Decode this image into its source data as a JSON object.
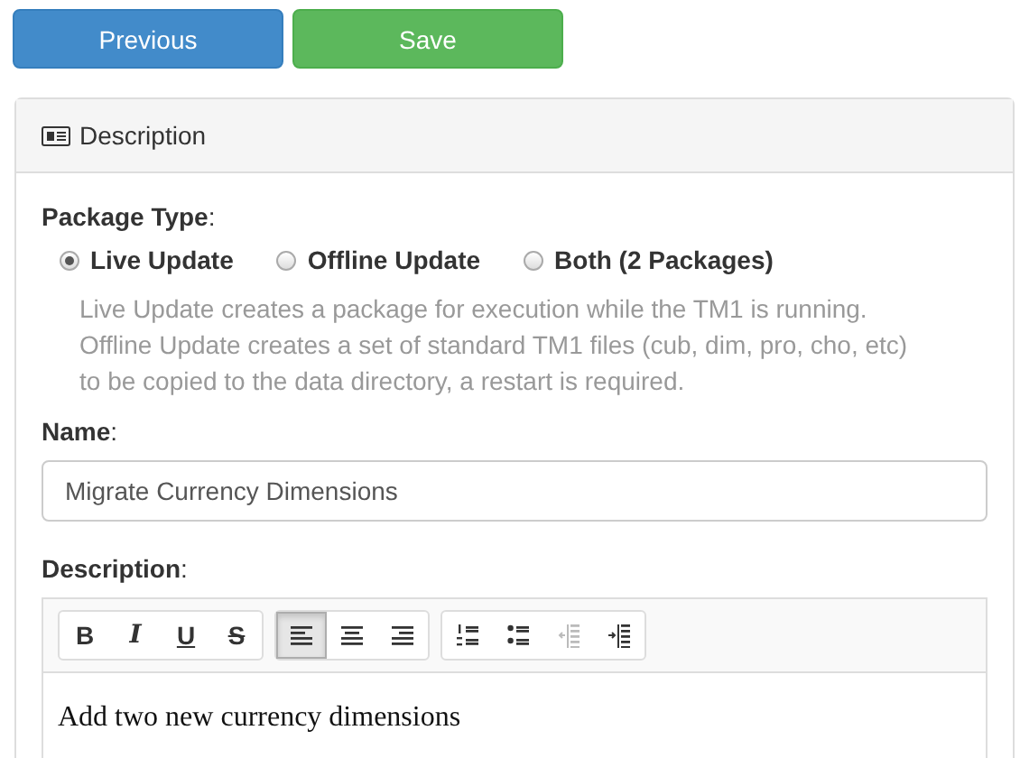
{
  "buttons": [
    {
      "label": "Previous",
      "kind": "primary"
    },
    {
      "label": "Save",
      "kind": "success"
    }
  ],
  "panel": {
    "title": "Description",
    "package_type": {
      "label": "Package Type",
      "suffix": ":",
      "options": [
        {
          "label": "Live Update",
          "selected": true
        },
        {
          "label": "Offline Update",
          "selected": false
        },
        {
          "label": "Both (2 Packages)",
          "selected": false
        }
      ],
      "help": [
        "Live Update creates a package for execution while the TM1 is running.",
        "Offline Update creates a set of standard TM1 files (cub, dim, pro, cho, etc)",
        "to be copied to the data directory, a restart is required."
      ]
    },
    "name": {
      "label": "Name",
      "suffix": ":",
      "value": "Migrate Currency Dimensions"
    },
    "description": {
      "label": "Description",
      "suffix": ":",
      "toolbar": [
        [
          {
            "kind": "bold",
            "label": "B",
            "selected": false,
            "disabled": false
          },
          {
            "kind": "italic",
            "label": "I",
            "selected": false,
            "disabled": false
          },
          {
            "kind": "underline",
            "label": "U",
            "selected": false,
            "disabled": false
          },
          {
            "kind": "strike",
            "label": "S",
            "selected": false,
            "disabled": false
          }
        ],
        [
          {
            "kind": "align-left",
            "selected": true,
            "disabled": false
          },
          {
            "kind": "align-center",
            "selected": false,
            "disabled": false
          },
          {
            "kind": "align-right",
            "selected": false,
            "disabled": false
          }
        ],
        [
          {
            "kind": "ordered-list",
            "selected": false,
            "disabled": false
          },
          {
            "kind": "bullet-list",
            "selected": false,
            "disabled": false
          },
          {
            "kind": "outdent",
            "selected": false,
            "disabled": true
          },
          {
            "kind": "indent",
            "selected": false,
            "disabled": false
          }
        ]
      ],
      "content": "Add two new currency dimensions"
    }
  }
}
